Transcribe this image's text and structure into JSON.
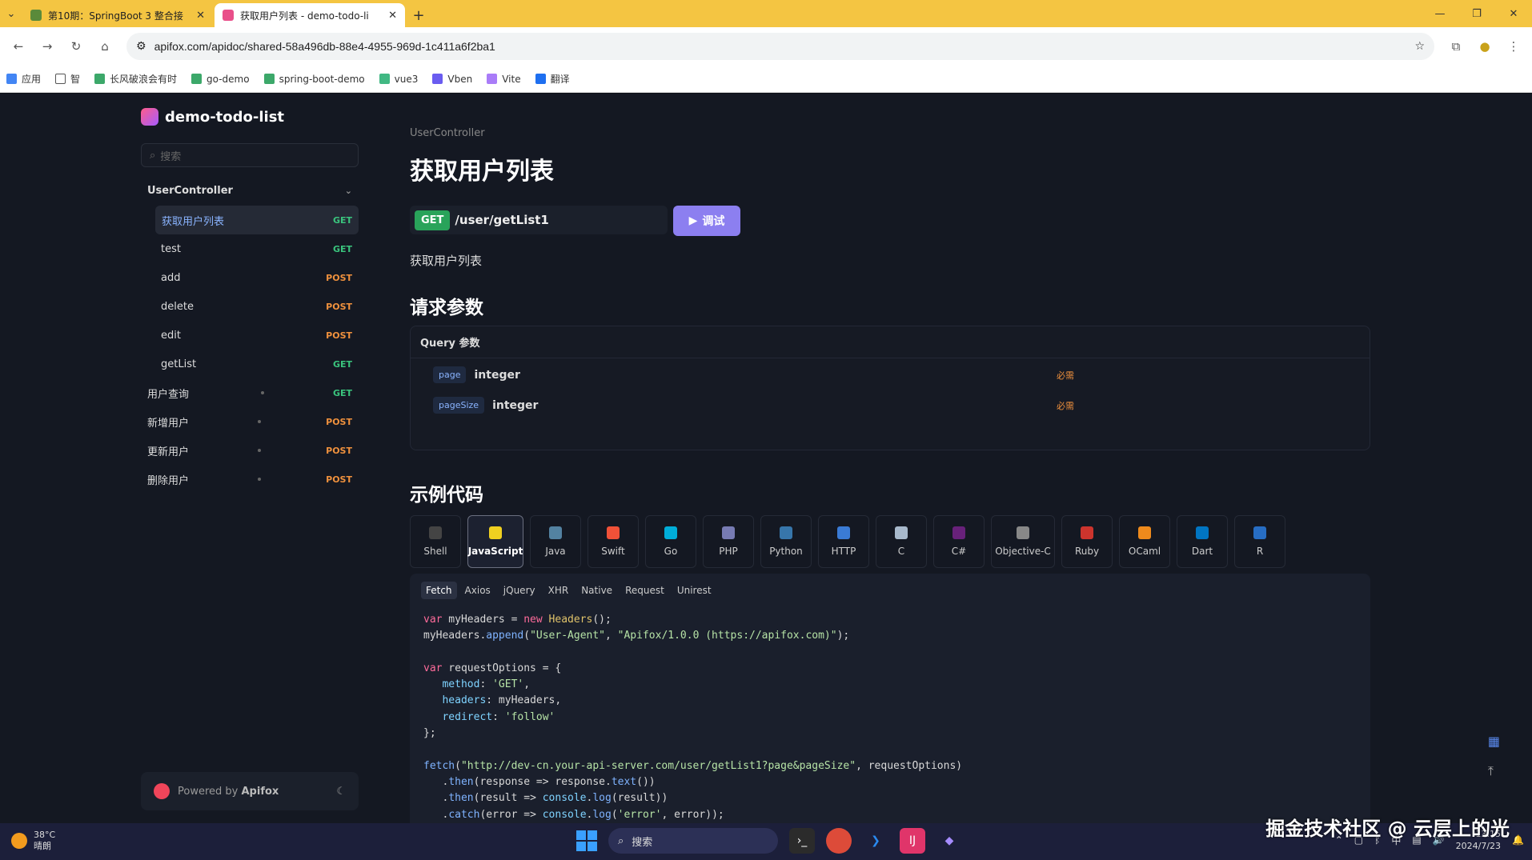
{
  "browser": {
    "tabs": [
      {
        "title": "第10期：SpringBoot 3 整合接",
        "active": false
      },
      {
        "title": "获取用户列表 - demo-todo-li",
        "active": true
      }
    ],
    "close_glyph": "✕",
    "new_tab_glyph": "+",
    "url": "apifox.com/apidoc/shared-58a496db-88e4-4955-969d-1c411a6f2ba1",
    "bookmarks": [
      "应用",
      "智",
      "长风破浪会有时",
      "go-demo",
      "spring-boot-demo",
      "vue3",
      "Vben",
      "Vite",
      "翻译"
    ]
  },
  "sidebar": {
    "project_name": "demo-todo-list",
    "search_placeholder": "搜索",
    "group_label": "UserController",
    "items": [
      {
        "label": "获取用户列表",
        "method": "GET",
        "selected": true
      },
      {
        "label": "test",
        "method": "GET"
      },
      {
        "label": "add",
        "method": "POST"
      },
      {
        "label": "delete",
        "method": "POST"
      },
      {
        "label": "edit",
        "method": "POST"
      },
      {
        "label": "getList",
        "method": "GET"
      },
      {
        "label": "用户查询",
        "method": "GET"
      },
      {
        "label": "新增用户",
        "method": "POST"
      },
      {
        "label": "更新用户",
        "method": "POST"
      },
      {
        "label": "删除用户",
        "method": "POST"
      }
    ],
    "powered_prefix": "Powered by",
    "powered_brand": "Apifox"
  },
  "main": {
    "breadcrumb": "UserController",
    "title": "获取用户列表",
    "method": "GET",
    "path": "/user/getList1",
    "try_label": "调试",
    "description": "获取用户列表",
    "request_params_heading": "请求参数",
    "query_heading": "Query 参数",
    "params": [
      {
        "name": "page",
        "type": "integer",
        "required": "必需"
      },
      {
        "name": "pageSize",
        "type": "integer",
        "required": "必需"
      }
    ],
    "example_heading": "示例代码",
    "languages": [
      "Shell",
      "JavaScript",
      "Java",
      "Swift",
      "Go",
      "PHP",
      "Python",
      "HTTP",
      "C",
      "C#",
      "Objective-C",
      "Ruby",
      "OCaml",
      "Dart",
      "R"
    ],
    "selected_language": "JavaScript",
    "libraries": [
      "Fetch",
      "Axios",
      "jQuery",
      "XHR",
      "Native",
      "Request",
      "Unirest"
    ],
    "selected_library": "Fetch",
    "code_lines": [
      "var myHeaders = new Headers();",
      "myHeaders.append(\"User-Agent\", \"Apifox/1.0.0 (https://apifox.com)\");",
      "",
      "var requestOptions = {",
      "   method: 'GET',",
      "   headers: myHeaders,",
      "   redirect: 'follow'",
      "};",
      "",
      "fetch(\"http://dev-cn.your-api-server.com/user/getList1?page&pageSize\", requestOptions)",
      "   .then(response => response.text())",
      "   .then(result => console.log(result))",
      "   .catch(error => console.log('error', error));"
    ]
  },
  "taskbar": {
    "temperature": "38°C",
    "weather": "晴朗",
    "search_label": "搜索",
    "ime": "中",
    "time": "13:15",
    "date": "2024/7/23"
  },
  "watermark": "掘金技术社区 @ 云层上的光",
  "colors": {
    "get": "#3ac47d",
    "post": "#f0913d",
    "accent": "#8c7ff0",
    "tabbar": "#f4c542"
  }
}
